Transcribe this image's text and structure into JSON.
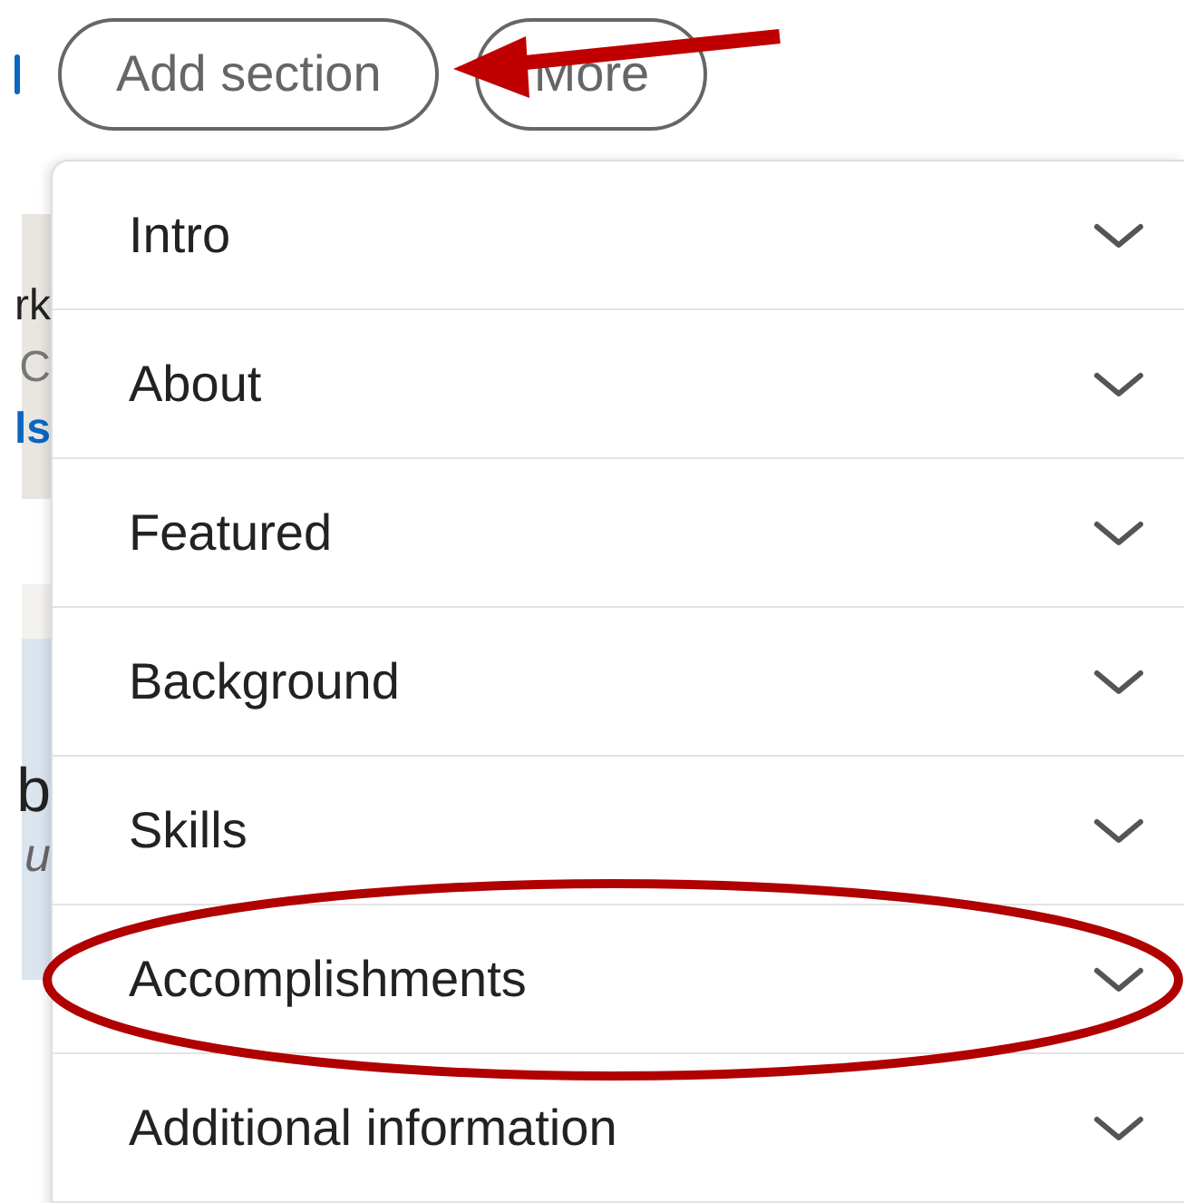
{
  "buttons": [
    {
      "label": "Add section"
    },
    {
      "label": "More"
    }
  ],
  "background_fragments": {
    "card_1": [
      "rk",
      "C",
      "ls"
    ],
    "card_2": [
      "b",
      "u"
    ]
  },
  "menu": {
    "items": [
      {
        "label": "Intro"
      },
      {
        "label": "About"
      },
      {
        "label": "Featured"
      },
      {
        "label": "Background"
      },
      {
        "label": "Skills"
      },
      {
        "label": "Accomplishments"
      },
      {
        "label": "Additional information"
      }
    ]
  }
}
